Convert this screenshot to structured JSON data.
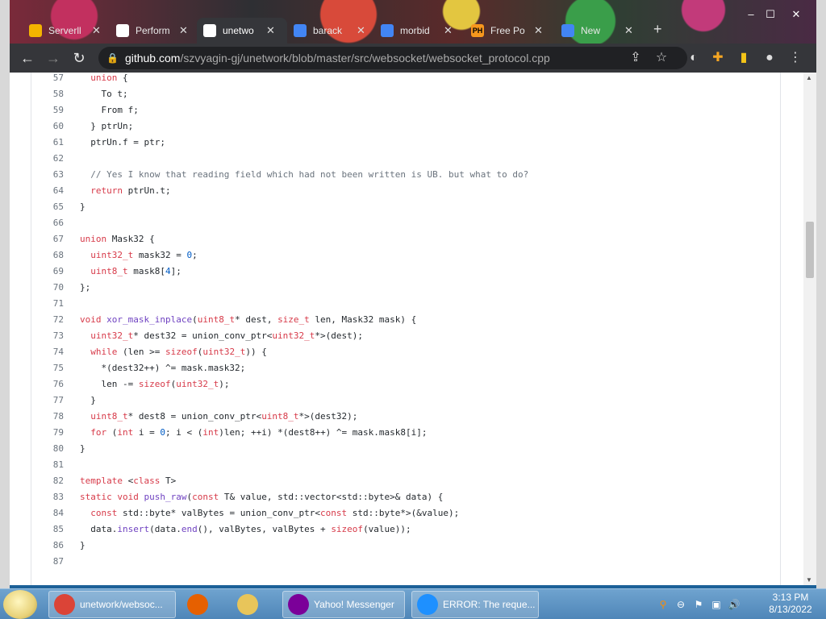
{
  "browser": {
    "tabs": [
      {
        "label": "Serverll",
        "active": false,
        "icon": "generic-site-icon",
        "color": "#f4b400"
      },
      {
        "label": "Perform",
        "active": false,
        "icon": "github-icon",
        "color": "#ffffff"
      },
      {
        "label": "unetwo",
        "active": true,
        "icon": "github-icon",
        "color": "#ffffff"
      },
      {
        "label": "barack",
        "active": false,
        "icon": "google-icon",
        "color": "#4285f4"
      },
      {
        "label": "morbid",
        "active": false,
        "icon": "google-icon",
        "color": "#4285f4"
      },
      {
        "label": "Free Po",
        "active": false,
        "icon": "ph-icon",
        "color": "#f7971d",
        "favtext": "PH"
      },
      {
        "label": "New",
        "active": false,
        "icon": "google-icon",
        "color": "#4285f4"
      }
    ],
    "new_tab": "+",
    "url_host": "github.com",
    "url_path": "/szvyagin-gj/unetwork/blob/master/src/websocket/websocket_protocol.cpp"
  },
  "code": {
    "lines": [
      {
        "n": "57",
        "t": [
          [
            "  ",
            ""
          ],
          [
            "union",
            "kw"
          ],
          [
            " {",
            ""
          ]
        ]
      },
      {
        "n": "58",
        "t": [
          [
            "    To t;",
            ""
          ]
        ]
      },
      {
        "n": "59",
        "t": [
          [
            "    From f;",
            ""
          ]
        ]
      },
      {
        "n": "60",
        "t": [
          [
            "  } ptrUn;",
            ""
          ]
        ]
      },
      {
        "n": "61",
        "t": [
          [
            "  ptrUn.f = ptr;",
            ""
          ]
        ]
      },
      {
        "n": "62",
        "t": []
      },
      {
        "n": "63",
        "t": [
          [
            "  // Yes I know that reading field which had not been written is UB. but what to do?",
            "cm"
          ]
        ]
      },
      {
        "n": "64",
        "t": [
          [
            "  ",
            ""
          ],
          [
            "return",
            "kw"
          ],
          [
            " ptrUn.t;",
            ""
          ]
        ]
      },
      {
        "n": "65",
        "t": [
          [
            "}",
            ""
          ]
        ]
      },
      {
        "n": "66",
        "t": []
      },
      {
        "n": "67",
        "t": [
          [
            "union",
            "kw"
          ],
          [
            " Mask32 {",
            ""
          ]
        ]
      },
      {
        "n": "68",
        "t": [
          [
            "  ",
            ""
          ],
          [
            "uint32_t",
            "kw"
          ],
          [
            " mask32 = ",
            ""
          ],
          [
            "0",
            "nm"
          ],
          [
            ";",
            ""
          ]
        ]
      },
      {
        "n": "69",
        "t": [
          [
            "  ",
            ""
          ],
          [
            "uint8_t",
            "kw"
          ],
          [
            " mask8[",
            ""
          ],
          [
            "4",
            "nm"
          ],
          [
            "];",
            ""
          ]
        ]
      },
      {
        "n": "70",
        "t": [
          [
            "};",
            ""
          ]
        ]
      },
      {
        "n": "71",
        "t": []
      },
      {
        "n": "72",
        "t": [
          [
            "void",
            "kw"
          ],
          [
            " ",
            ""
          ],
          [
            "xor_mask_inplace",
            "fn"
          ],
          [
            "(",
            ""
          ],
          [
            "uint8_t",
            "kw"
          ],
          [
            "* dest, ",
            ""
          ],
          [
            "size_t",
            "kw"
          ],
          [
            " len, Mask32 mask) {",
            ""
          ]
        ]
      },
      {
        "n": "73",
        "t": [
          [
            "  ",
            ""
          ],
          [
            "uint32_t",
            "kw"
          ],
          [
            "* dest32 = union_conv_ptr<",
            ""
          ],
          [
            "uint32_t",
            "kw"
          ],
          [
            "*>(dest);",
            ""
          ]
        ]
      },
      {
        "n": "74",
        "t": [
          [
            "  ",
            ""
          ],
          [
            "while",
            "kw"
          ],
          [
            " (len >= ",
            ""
          ],
          [
            "sizeof",
            "kw"
          ],
          [
            "(",
            ""
          ],
          [
            "uint32_t",
            "kw"
          ],
          [
            ")) {",
            ""
          ]
        ]
      },
      {
        "n": "75",
        "t": [
          [
            "    *(dest32++) ^= mask.mask32;",
            ""
          ]
        ]
      },
      {
        "n": "76",
        "t": [
          [
            "    len -= ",
            ""
          ],
          [
            "sizeof",
            "kw"
          ],
          [
            "(",
            ""
          ],
          [
            "uint32_t",
            "kw"
          ],
          [
            ");",
            ""
          ]
        ]
      },
      {
        "n": "77",
        "t": [
          [
            "  }",
            ""
          ]
        ]
      },
      {
        "n": "78",
        "t": [
          [
            "  ",
            ""
          ],
          [
            "uint8_t",
            "kw"
          ],
          [
            "* dest8 = union_conv_ptr<",
            ""
          ],
          [
            "uint8_t",
            "kw"
          ],
          [
            "*>(dest32);",
            ""
          ]
        ]
      },
      {
        "n": "79",
        "t": [
          [
            "  ",
            ""
          ],
          [
            "for",
            "kw"
          ],
          [
            " (",
            ""
          ],
          [
            "int",
            "kw"
          ],
          [
            " i = ",
            ""
          ],
          [
            "0",
            "nm"
          ],
          [
            "; i < (",
            ""
          ],
          [
            "int",
            "kw"
          ],
          [
            ")len; ++i) *(dest8++) ^= mask.mask8[i];",
            ""
          ]
        ]
      },
      {
        "n": "80",
        "t": [
          [
            "}",
            ""
          ]
        ]
      },
      {
        "n": "81",
        "t": []
      },
      {
        "n": "82",
        "t": [
          [
            "template",
            "kw"
          ],
          [
            " <",
            ""
          ],
          [
            "class",
            "kw"
          ],
          [
            " T>",
            ""
          ]
        ]
      },
      {
        "n": "83",
        "t": [
          [
            "static",
            "kw"
          ],
          [
            " ",
            ""
          ],
          [
            "void",
            "kw"
          ],
          [
            " ",
            ""
          ],
          [
            "push_raw",
            "fn"
          ],
          [
            "(",
            ""
          ],
          [
            "const",
            "kw"
          ],
          [
            " T& value, std::vector<std::byte>& data) {",
            ""
          ]
        ]
      },
      {
        "n": "84",
        "t": [
          [
            "  ",
            ""
          ],
          [
            "const",
            "kw"
          ],
          [
            " std::byte* valBytes = union_conv_ptr<",
            ""
          ],
          [
            "const",
            "kw"
          ],
          [
            " std::byte*>(&value);",
            ""
          ]
        ]
      },
      {
        "n": "85",
        "t": [
          [
            "  data.",
            ""
          ],
          [
            "insert",
            "fn"
          ],
          [
            "(data.",
            ""
          ],
          [
            "end",
            "fn"
          ],
          [
            "(), valBytes, valBytes + ",
            ""
          ],
          [
            "sizeof",
            "kw"
          ],
          [
            "(value));",
            ""
          ]
        ]
      },
      {
        "n": "86",
        "t": [
          [
            "}",
            ""
          ]
        ]
      },
      {
        "n": "87",
        "t": []
      }
    ]
  },
  "taskbar": {
    "items": [
      {
        "label": "unetwork/websoc...",
        "icon": "chrome-icon",
        "color": "#db4437",
        "grouped": true
      },
      {
        "label": "",
        "icon": "firefox-icon",
        "color": "#e66000",
        "grouped": false
      },
      {
        "label": "",
        "icon": "folder-icon",
        "color": "#e8c55a",
        "grouped": false
      },
      {
        "label": "Yahoo! Messenger",
        "icon": "yahoo-icon",
        "color": "#7b0099",
        "grouped": true
      },
      {
        "label": "ERROR: The reque...",
        "icon": "ie-icon",
        "color": "#1e90ff",
        "grouped": true
      }
    ],
    "time": "3:13 PM",
    "date": "8/13/2022"
  }
}
